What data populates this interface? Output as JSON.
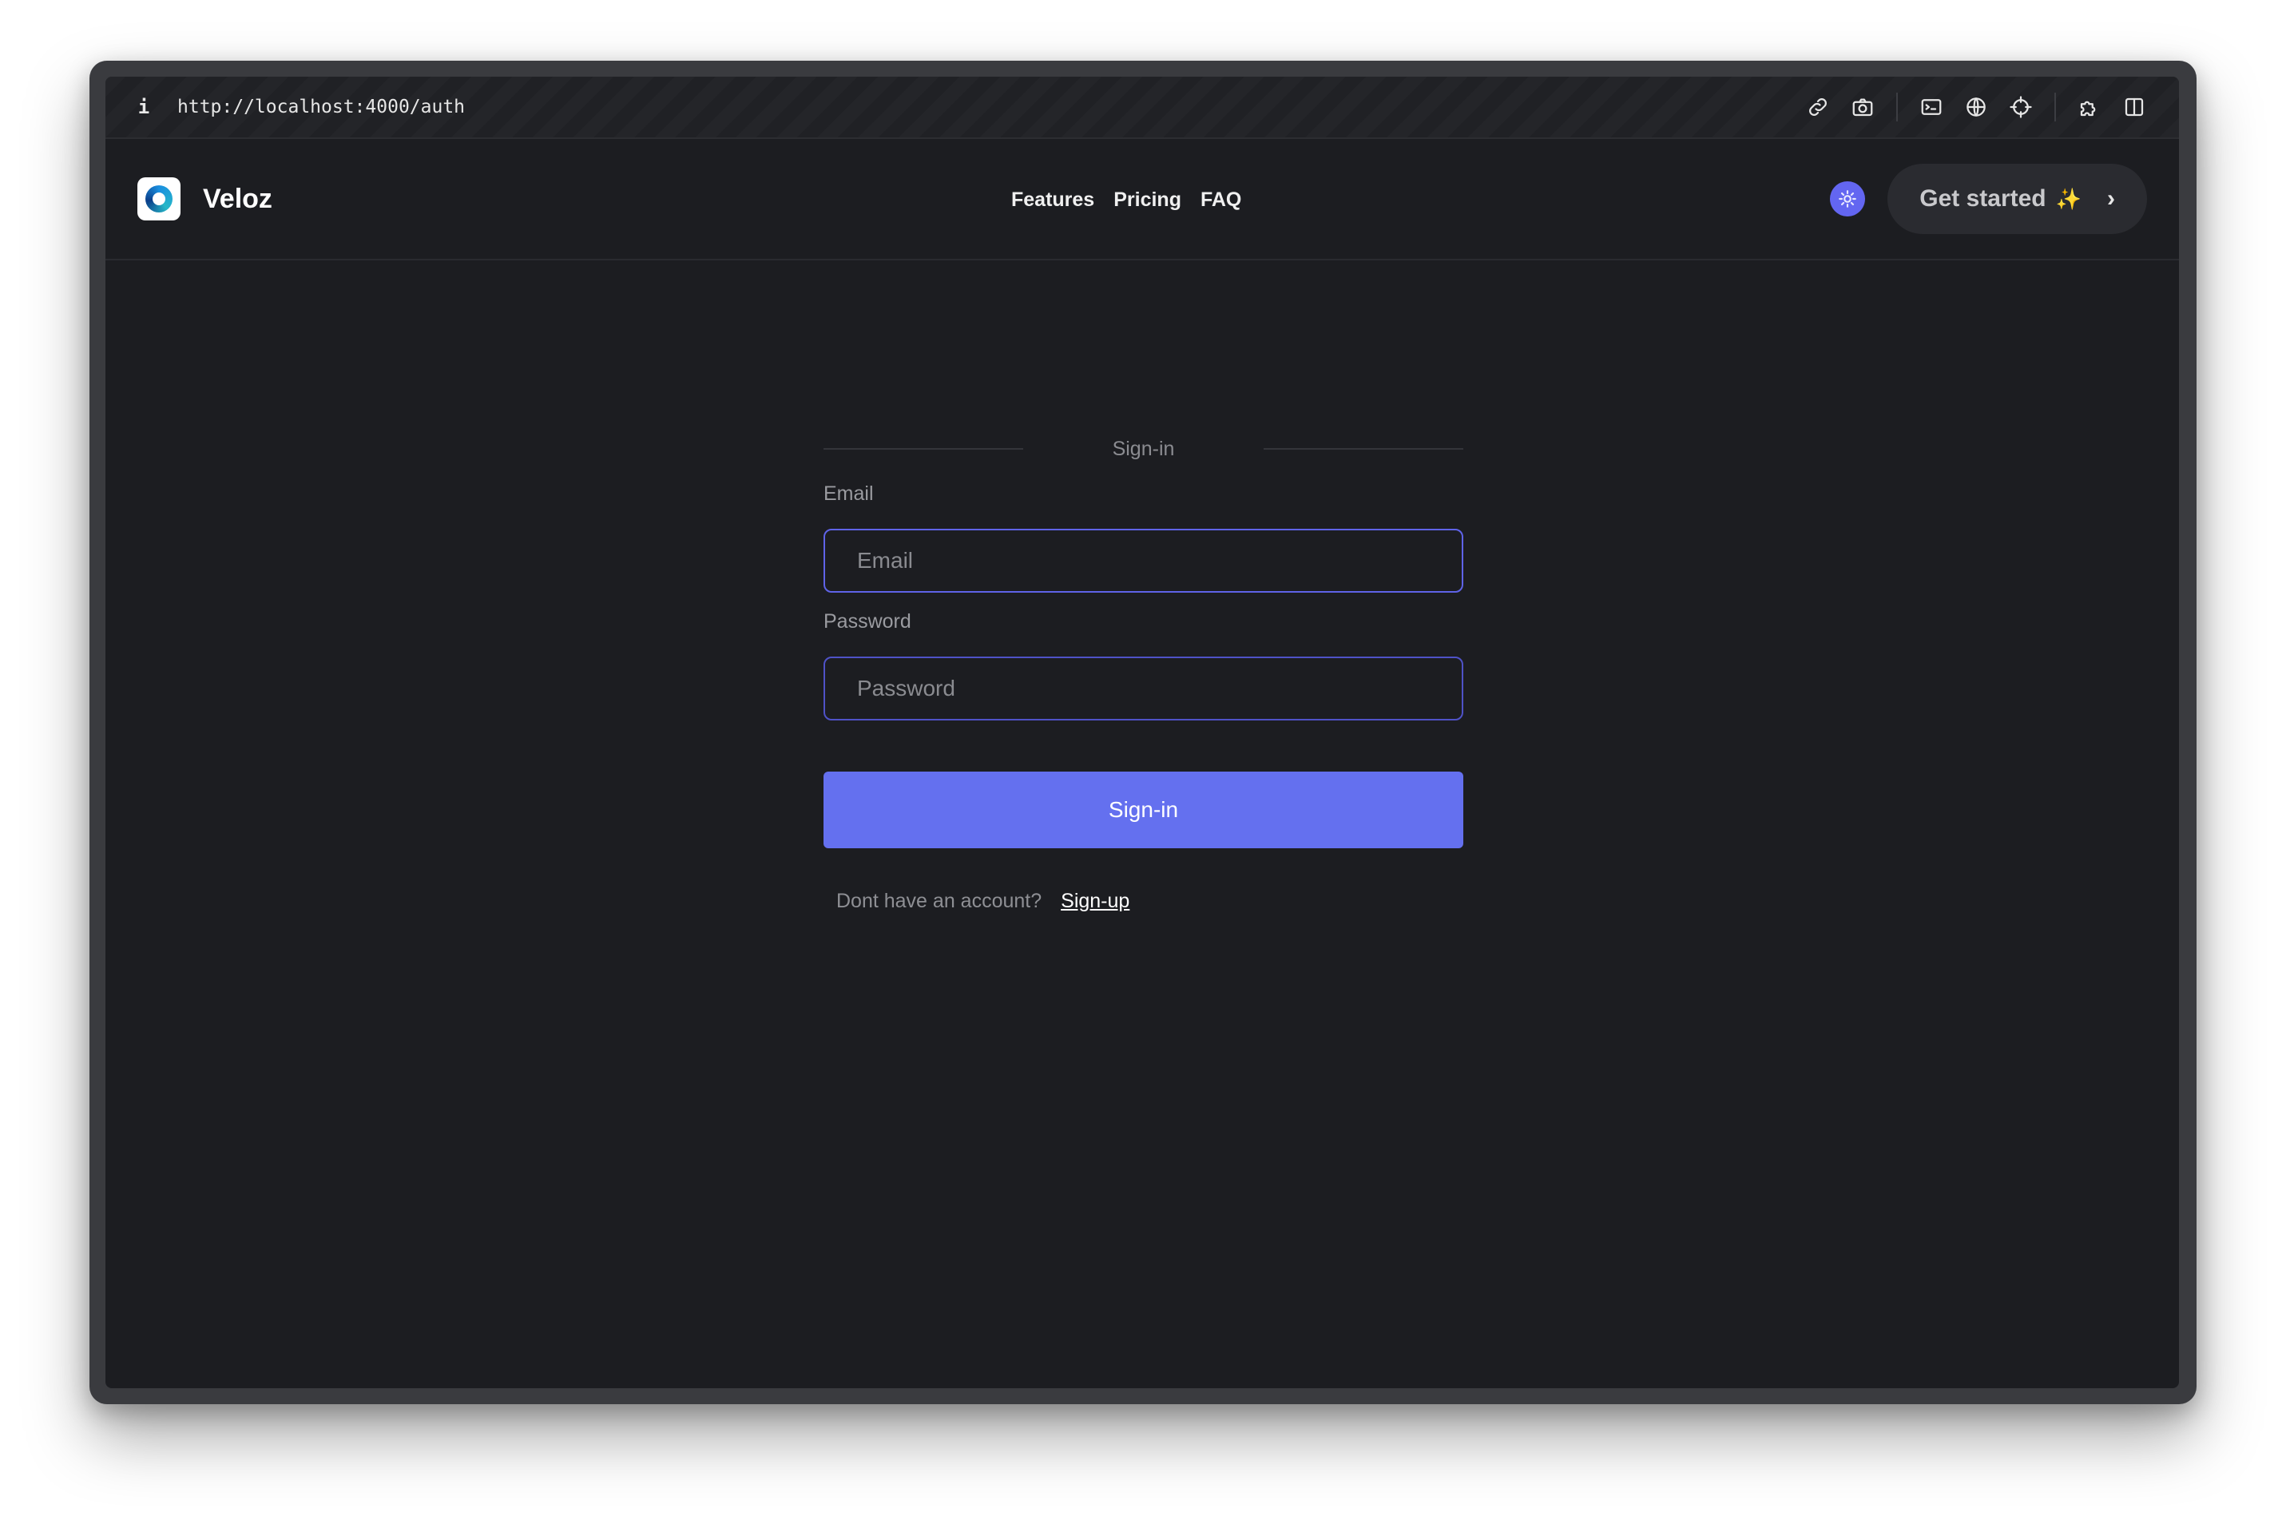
{
  "browser": {
    "url": "http://localhost:4000/auth",
    "info_glyph": "i",
    "tools": [
      "link-icon",
      "camera-icon",
      "terminal-icon",
      "globe-icon",
      "crosshair-icon",
      "extensions-icon",
      "split-view-icon"
    ]
  },
  "header": {
    "brand": "Veloz",
    "nav": [
      "Features",
      "Pricing",
      "FAQ"
    ],
    "cta_label": "Get started",
    "cta_sparkle": "✨",
    "cta_chevron": "›"
  },
  "auth": {
    "divider_label": "Sign-in",
    "email_label": "Email",
    "email_placeholder": "Email",
    "email_value": "",
    "password_label": "Password",
    "password_placeholder": "Password",
    "password_value": "",
    "submit_label": "Sign-in",
    "signup_prompt": "Dont have an account?",
    "signup_link": "Sign-up"
  },
  "colors": {
    "accent": "#6470ef",
    "background": "#1c1d21",
    "input_border": "#5f63e8"
  }
}
